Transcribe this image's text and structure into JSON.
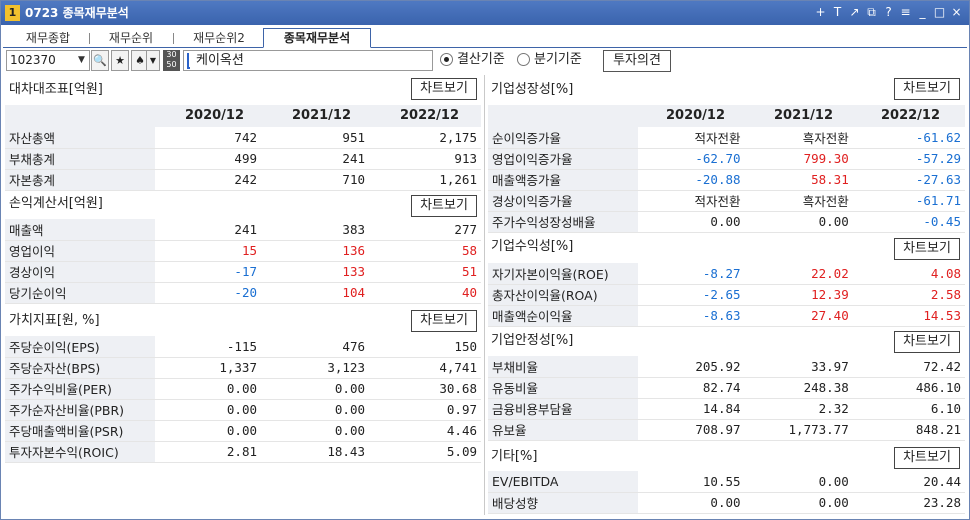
{
  "window": {
    "number": "1",
    "title": "0723 종목재무분석",
    "controls": [
      "+",
      "T",
      "↗",
      "⧉",
      "?",
      "≡",
      "_",
      "□",
      "×"
    ]
  },
  "tabs": [
    "재무종합",
    "재무순위",
    "재무순위2",
    "종목재무분석"
  ],
  "toolbar": {
    "code": "102370",
    "year_box": [
      "30",
      "50"
    ],
    "company": "케이옥션",
    "radio_settlement": "결산기준",
    "radio_quarter": "분기기준",
    "invest_button": "투자의견"
  },
  "chart_btn": "차트보기",
  "years": [
    "2020/12",
    "2021/12",
    "2022/12"
  ],
  "left": {
    "balance": {
      "title": "대차대조표[억원]",
      "rows": [
        {
          "label": "자산총액",
          "v": [
            "742",
            "951",
            "2,175"
          ],
          "c": [
            "",
            "",
            ""
          ]
        },
        {
          "label": "부채총계",
          "v": [
            "499",
            "241",
            "913"
          ],
          "c": [
            "",
            "",
            ""
          ]
        },
        {
          "label": "자본총계",
          "v": [
            "242",
            "710",
            "1,261"
          ],
          "c": [
            "",
            "",
            ""
          ]
        }
      ]
    },
    "income": {
      "title": "손익계산서[억원]",
      "rows": [
        {
          "label": "매출액",
          "v": [
            "241",
            "383",
            "277"
          ],
          "c": [
            "",
            "",
            ""
          ]
        },
        {
          "label": "영업이익",
          "v": [
            "15",
            "136",
            "58"
          ],
          "c": [
            "red",
            "red",
            "red"
          ]
        },
        {
          "label": "경상이익",
          "v": [
            "-17",
            "133",
            "51"
          ],
          "c": [
            "blue",
            "red",
            "red"
          ]
        },
        {
          "label": "당기순이익",
          "v": [
            "-20",
            "104",
            "40"
          ],
          "c": [
            "blue",
            "red",
            "red"
          ]
        }
      ]
    },
    "value": {
      "title": "가치지표[원, %]",
      "rows": [
        {
          "label": "주당순이익(EPS)",
          "v": [
            "-115",
            "476",
            "150"
          ],
          "c": [
            "",
            "",
            ""
          ]
        },
        {
          "label": "주당순자산(BPS)",
          "v": [
            "1,337",
            "3,123",
            "4,741"
          ],
          "c": [
            "",
            "",
            ""
          ]
        },
        {
          "label": "주가수익비율(PER)",
          "v": [
            "0.00",
            "0.00",
            "30.68"
          ],
          "c": [
            "",
            "",
            ""
          ]
        },
        {
          "label": "주가순자산비율(PBR)",
          "v": [
            "0.00",
            "0.00",
            "0.97"
          ],
          "c": [
            "",
            "",
            ""
          ]
        },
        {
          "label": "주당매출액비율(PSR)",
          "v": [
            "0.00",
            "0.00",
            "4.46"
          ],
          "c": [
            "",
            "",
            ""
          ]
        },
        {
          "label": "투자자본수익(ROIC)",
          "v": [
            "2.81",
            "18.43",
            "5.09"
          ],
          "c": [
            "",
            "",
            ""
          ]
        }
      ]
    }
  },
  "right": {
    "growth": {
      "title": "기업성장성[%]",
      "rows": [
        {
          "label": "순이익증가율",
          "v": [
            "적자전환",
            "흑자전환",
            "-61.62"
          ],
          "c": [
            "",
            "",
            "blue"
          ]
        },
        {
          "label": "영업이익증가율",
          "v": [
            "-62.70",
            "799.30",
            "-57.29"
          ],
          "c": [
            "blue",
            "red",
            "blue"
          ]
        },
        {
          "label": "매출액증가율",
          "v": [
            "-20.88",
            "58.31",
            "-27.63"
          ],
          "c": [
            "blue",
            "red",
            "blue"
          ]
        },
        {
          "label": "경상이익증가율",
          "v": [
            "적자전환",
            "흑자전환",
            "-61.71"
          ],
          "c": [
            "",
            "",
            "blue"
          ]
        },
        {
          "label": "주가수익성장성배율",
          "v": [
            "0.00",
            "0.00",
            "-0.45"
          ],
          "c": [
            "",
            "",
            "blue"
          ]
        }
      ]
    },
    "profit": {
      "title": "기업수익성[%]",
      "rows": [
        {
          "label": "자기자본이익율(ROE)",
          "v": [
            "-8.27",
            "22.02",
            "4.08"
          ],
          "c": [
            "blue",
            "red",
            "red"
          ]
        },
        {
          "label": "총자산이익율(ROA)",
          "v": [
            "-2.65",
            "12.39",
            "2.58"
          ],
          "c": [
            "blue",
            "red",
            "red"
          ]
        },
        {
          "label": "매출액순이익율",
          "v": [
            "-8.63",
            "27.40",
            "14.53"
          ],
          "c": [
            "blue",
            "red",
            "red"
          ]
        }
      ]
    },
    "stability": {
      "title": "기업안정성[%]",
      "rows": [
        {
          "label": "부채비율",
          "v": [
            "205.92",
            "33.97",
            "72.42"
          ],
          "c": [
            "",
            "",
            ""
          ]
        },
        {
          "label": "유동비율",
          "v": [
            "82.74",
            "248.38",
            "486.10"
          ],
          "c": [
            "",
            "",
            ""
          ]
        },
        {
          "label": "금융비용부담율",
          "v": [
            "14.84",
            "2.32",
            "6.10"
          ],
          "c": [
            "",
            "",
            ""
          ]
        },
        {
          "label": "유보율",
          "v": [
            "708.97",
            "1,773.77",
            "848.21"
          ],
          "c": [
            "",
            "",
            ""
          ]
        }
      ]
    },
    "etc": {
      "title": "기타[%]",
      "rows": [
        {
          "label": "EV/EBITDA",
          "v": [
            "10.55",
            "0.00",
            "20.44"
          ],
          "c": [
            "",
            "",
            ""
          ]
        },
        {
          "label": "배당성향",
          "v": [
            "0.00",
            "0.00",
            "23.28"
          ],
          "c": [
            "",
            "",
            ""
          ]
        }
      ]
    }
  }
}
